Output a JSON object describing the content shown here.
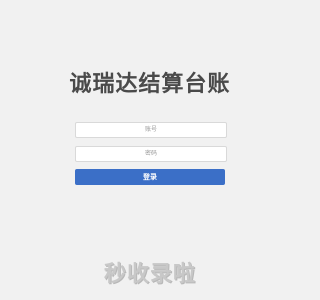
{
  "header": {
    "title": "诚瑞达结算台账"
  },
  "form": {
    "account_placeholder": "账号",
    "password_placeholder": "密码",
    "login_label": "登录"
  },
  "watermark": {
    "text": "秒收录啦"
  },
  "colors": {
    "background": "#f1f1f1",
    "accent": "#3b6fc7",
    "title": "#4a4a4a"
  }
}
